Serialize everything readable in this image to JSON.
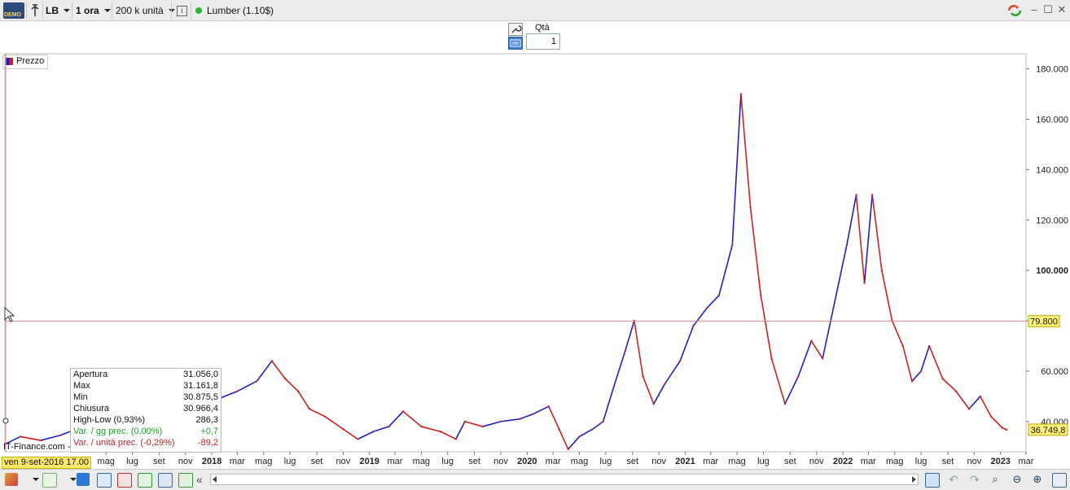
{
  "toolbar": {
    "demo_label": "DEMO",
    "ticker": "LB",
    "interval": "1 ora",
    "units": "200 k unità",
    "info_icon": "i",
    "instrument": "Lumber (1.10$)"
  },
  "order": {
    "qty_label": "Qtà",
    "qty_value": "1"
  },
  "legend": {
    "label": "Prezzo"
  },
  "source": "IT-Finance.com -",
  "cursor_date": "ven 9-set-2016 17.00",
  "cursor_price": "79.800",
  "last_price": "36.749,8",
  "infobox": {
    "rows": [
      {
        "label": "Apertura",
        "value": "31.056,0",
        "color": "#111111"
      },
      {
        "label": "Max",
        "value": "31.161,8",
        "color": "#111111"
      },
      {
        "label": "Min",
        "value": "30.875,5",
        "color": "#111111"
      },
      {
        "label": "Chiusura",
        "value": "30.966,4",
        "color": "#111111"
      },
      {
        "label": "High-Low (0,93%)",
        "value": "286,3",
        "color": "#111111"
      },
      {
        "label": "Var. / gg prec. (0,00%)",
        "value": "+0,7",
        "color": "#1f9f2f"
      },
      {
        "label": "Var. / unità prec. (-0,29%)",
        "value": "-89,2",
        "color": "#c0202a"
      }
    ]
  },
  "colors": {
    "up": "#1f1fc8",
    "down": "#d41f1f",
    "crosshair": "#e08a8a",
    "badge": "#fff27a"
  },
  "chart_data": {
    "type": "line",
    "title": "",
    "xlabel": "",
    "ylabel": "",
    "ylim": [
      28000,
      186000
    ],
    "y_ticks": [
      {
        "value": 40000,
        "label": "40.000"
      },
      {
        "value": 60000,
        "label": "60.000"
      },
      {
        "value": 80000,
        "label": ""
      },
      {
        "value": 100000,
        "label": "100.000"
      },
      {
        "value": 120000,
        "label": "120.000"
      },
      {
        "value": 140000,
        "label": "140.000"
      },
      {
        "value": 160000,
        "label": "160.000"
      },
      {
        "value": 180000,
        "label": "180.000"
      }
    ],
    "x_ticks": [
      {
        "date": "2017-05-01",
        "label": "mag",
        "bold": false
      },
      {
        "date": "2017-07-01",
        "label": "lug",
        "bold": false
      },
      {
        "date": "2017-09-01",
        "label": "set",
        "bold": false
      },
      {
        "date": "2017-11-01",
        "label": "nov",
        "bold": false
      },
      {
        "date": "2018-01-01",
        "label": "2018",
        "bold": true
      },
      {
        "date": "2018-03-01",
        "label": "mar",
        "bold": false
      },
      {
        "date": "2018-05-01",
        "label": "mag",
        "bold": false
      },
      {
        "date": "2018-07-01",
        "label": "lug",
        "bold": false
      },
      {
        "date": "2018-09-01",
        "label": "set",
        "bold": false
      },
      {
        "date": "2018-11-01",
        "label": "nov",
        "bold": false
      },
      {
        "date": "2019-01-01",
        "label": "2019",
        "bold": true
      },
      {
        "date": "2019-03-01",
        "label": "mar",
        "bold": false
      },
      {
        "date": "2019-05-01",
        "label": "mag",
        "bold": false
      },
      {
        "date": "2019-07-01",
        "label": "lug",
        "bold": false
      },
      {
        "date": "2019-09-01",
        "label": "set",
        "bold": false
      },
      {
        "date": "2019-11-01",
        "label": "nov",
        "bold": false
      },
      {
        "date": "2020-01-01",
        "label": "2020",
        "bold": true
      },
      {
        "date": "2020-03-01",
        "label": "mar",
        "bold": false
      },
      {
        "date": "2020-05-01",
        "label": "mag",
        "bold": false
      },
      {
        "date": "2020-07-01",
        "label": "lug",
        "bold": false
      },
      {
        "date": "2020-09-01",
        "label": "set",
        "bold": false
      },
      {
        "date": "2020-11-01",
        "label": "nov",
        "bold": false
      },
      {
        "date": "2021-01-01",
        "label": "2021",
        "bold": true
      },
      {
        "date": "2021-03-01",
        "label": "mar",
        "bold": false
      },
      {
        "date": "2021-05-01",
        "label": "mag",
        "bold": false
      },
      {
        "date": "2021-07-01",
        "label": "lug",
        "bold": false
      },
      {
        "date": "2021-09-01",
        "label": "set",
        "bold": false
      },
      {
        "date": "2021-11-01",
        "label": "nov",
        "bold": false
      },
      {
        "date": "2022-01-01",
        "label": "2022",
        "bold": true
      },
      {
        "date": "2022-03-01",
        "label": "mar",
        "bold": false
      },
      {
        "date": "2022-05-01",
        "label": "mag",
        "bold": false
      },
      {
        "date": "2022-07-01",
        "label": "lug",
        "bold": false
      },
      {
        "date": "2022-09-01",
        "label": "set",
        "bold": false
      },
      {
        "date": "2022-11-01",
        "label": "nov",
        "bold": false
      },
      {
        "date": "2023-01-01",
        "label": "2023",
        "bold": true
      },
      {
        "date": "2023-03-01",
        "label": "mar",
        "bold": false
      }
    ],
    "xlim": [
      "2016-09-09",
      "2023-03-01"
    ],
    "series": [
      {
        "points": [
          {
            "x": "2016-09-09",
            "y": 31000
          },
          {
            "x": "2016-10-15",
            "y": 34000
          },
          {
            "x": "2016-12-01",
            "y": 32500
          },
          {
            "x": "2017-01-15",
            "y": 34500
          },
          {
            "x": "2017-03-01",
            "y": 37500
          },
          {
            "x": "2017-05-01",
            "y": 39000
          },
          {
            "x": "2017-07-01",
            "y": 41000
          },
          {
            "x": "2017-09-01",
            "y": 44000
          },
          {
            "x": "2017-11-01",
            "y": 46000
          },
          {
            "x": "2018-01-01",
            "y": 48000
          },
          {
            "x": "2018-03-01",
            "y": 52000
          },
          {
            "x": "2018-04-15",
            "y": 56000
          },
          {
            "x": "2018-05-20",
            "y": 64000
          },
          {
            "x": "2018-06-20",
            "y": 57000
          },
          {
            "x": "2018-07-20",
            "y": 52000
          },
          {
            "x": "2018-08-15",
            "y": 45000
          },
          {
            "x": "2018-09-20",
            "y": 42000
          },
          {
            "x": "2018-11-01",
            "y": 37000
          },
          {
            "x": "2018-12-05",
            "y": 33000
          },
          {
            "x": "2019-01-10",
            "y": 36000
          },
          {
            "x": "2019-02-15",
            "y": 38000
          },
          {
            "x": "2019-03-20",
            "y": 44000
          },
          {
            "x": "2019-05-01",
            "y": 38000
          },
          {
            "x": "2019-06-15",
            "y": 36000
          },
          {
            "x": "2019-07-20",
            "y": 33000
          },
          {
            "x": "2019-08-10",
            "y": 40000
          },
          {
            "x": "2019-09-20",
            "y": 38000
          },
          {
            "x": "2019-11-01",
            "y": 40000
          },
          {
            "x": "2019-12-15",
            "y": 41000
          },
          {
            "x": "2020-01-15",
            "y": 43000
          },
          {
            "x": "2020-02-20",
            "y": 46000
          },
          {
            "x": "2020-03-15",
            "y": 37000
          },
          {
            "x": "2020-04-05",
            "y": 29000
          },
          {
            "x": "2020-05-01",
            "y": 34000
          },
          {
            "x": "2020-06-01",
            "y": 37000
          },
          {
            "x": "2020-06-25",
            "y": 40000
          },
          {
            "x": "2020-07-20",
            "y": 54000
          },
          {
            "x": "2020-08-15",
            "y": 68000
          },
          {
            "x": "2020-09-05",
            "y": 80000
          },
          {
            "x": "2020-09-25",
            "y": 58000
          },
          {
            "x": "2020-10-20",
            "y": 47000
          },
          {
            "x": "2020-11-15",
            "y": 55000
          },
          {
            "x": "2020-12-20",
            "y": 64000
          },
          {
            "x": "2021-01-20",
            "y": 78000
          },
          {
            "x": "2021-02-20",
            "y": 85000
          },
          {
            "x": "2021-03-20",
            "y": 90000
          },
          {
            "x": "2021-04-20",
            "y": 110000
          },
          {
            "x": "2021-05-10",
            "y": 170000
          },
          {
            "x": "2021-06-01",
            "y": 125000
          },
          {
            "x": "2021-06-25",
            "y": 90000
          },
          {
            "x": "2021-07-20",
            "y": 65000
          },
          {
            "x": "2021-08-20",
            "y": 47000
          },
          {
            "x": "2021-09-20",
            "y": 58000
          },
          {
            "x": "2021-10-20",
            "y": 72000
          },
          {
            "x": "2021-11-15",
            "y": 65000
          },
          {
            "x": "2021-12-10",
            "y": 85000
          },
          {
            "x": "2022-01-10",
            "y": 110000
          },
          {
            "x": "2022-02-01",
            "y": 130000
          },
          {
            "x": "2022-02-20",
            "y": 95000
          },
          {
            "x": "2022-03-10",
            "y": 130000
          },
          {
            "x": "2022-04-01",
            "y": 100000
          },
          {
            "x": "2022-04-25",
            "y": 80000
          },
          {
            "x": "2022-05-20",
            "y": 70000
          },
          {
            "x": "2022-06-10",
            "y": 56000
          },
          {
            "x": "2022-07-01",
            "y": 60000
          },
          {
            "x": "2022-07-20",
            "y": 70000
          },
          {
            "x": "2022-08-20",
            "y": 57000
          },
          {
            "x": "2022-09-20",
            "y": 52000
          },
          {
            "x": "2022-10-20",
            "y": 45000
          },
          {
            "x": "2022-11-15",
            "y": 50000
          },
          {
            "x": "2022-12-10",
            "y": 42000
          },
          {
            "x": "2023-01-05",
            "y": 37500
          },
          {
            "x": "2023-01-15",
            "y": 36750
          }
        ]
      }
    ]
  },
  "bottom": {
    "collapse_label": "«"
  }
}
